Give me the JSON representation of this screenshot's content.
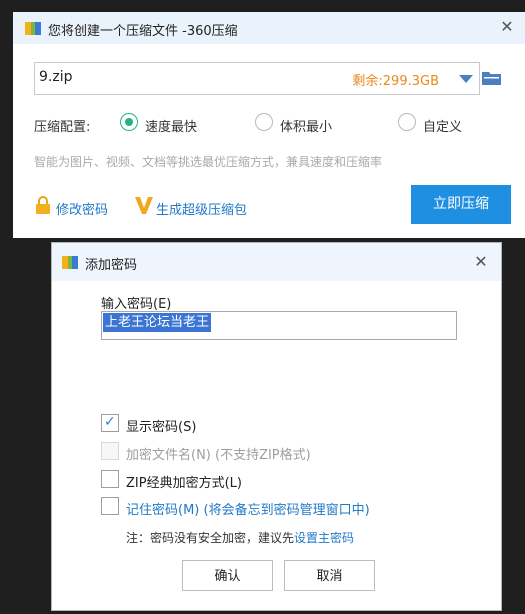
{
  "main_window": {
    "title": "您将创建一个压缩文件 -360压缩",
    "file_name": "9.zip",
    "remaining": "剩余:299.3GB",
    "config_label": "压缩配置:",
    "options": [
      "速度最快",
      "体积最小",
      "自定义"
    ],
    "selected_option": "速度最快",
    "hint": "智能为图片、视频、文档等挑选最优压缩方式，兼具速度和压缩率",
    "change_password": "修改密码",
    "super_package": "生成超级压缩包",
    "compress_button": "立即压缩"
  },
  "dialog": {
    "title": "添加密码",
    "password_label": "输入密码(E)",
    "password_value": "上老王论坛当老王",
    "options": [
      {
        "label": "显示密码(S)",
        "checked": true,
        "disabled": false
      },
      {
        "label": "加密文件名(N) (不支持ZIP格式)",
        "checked": false,
        "disabled": true
      },
      {
        "label": "ZIP经典加密方式(L)",
        "checked": false,
        "disabled": false
      },
      {
        "label": "记住密码(M) (将会备忘到密码管理窗口中)",
        "checked": false,
        "disabled": false
      }
    ],
    "note_prefix": "注：密码没有安全加密，建议先",
    "note_link": "设置主密码",
    "ok_button": "确认",
    "cancel_button": "取消"
  },
  "colors": {
    "accent": "#1e8fe1",
    "remaining": "#e8891c",
    "radio_selected": "#27b37d"
  }
}
